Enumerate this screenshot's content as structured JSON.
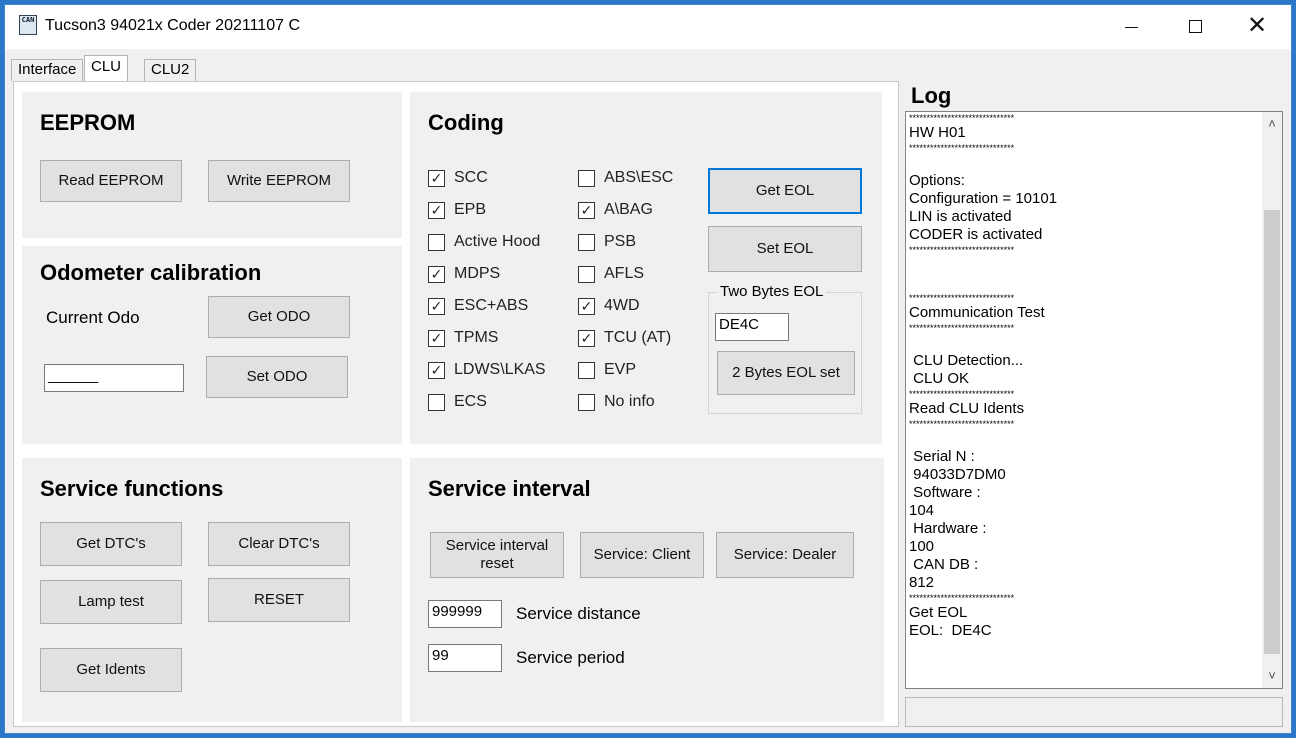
{
  "window": {
    "title": "Tucson3 94021x  Coder 20211107 C",
    "icon_text": "CAN",
    "close_glyph": "✕"
  },
  "tabs": [
    "Interface",
    "CLU",
    "CLU2"
  ],
  "eeprom": {
    "title": "EEPROM",
    "read_label": "Read EEPROM",
    "write_label": "Write EEPROM"
  },
  "odometer": {
    "title": "Odometer calibration",
    "current_label": "Current Odo",
    "get_label": "Get ODO",
    "set_label": "Set ODO",
    "input_value": "______"
  },
  "service_functions": {
    "title": "Service functions",
    "get_dtc": "Get DTC's",
    "clear_dtc": "Clear DTC's",
    "lamp_test": "Lamp test",
    "reset": "RESET",
    "get_idents": "Get Idents"
  },
  "coding": {
    "title": "Coding",
    "col1": [
      {
        "label": "SCC",
        "checked": true
      },
      {
        "label": "EPB",
        "checked": true
      },
      {
        "label": "Active Hood",
        "checked": false
      },
      {
        "label": "MDPS",
        "checked": true
      },
      {
        "label": "ESC+ABS",
        "checked": true
      },
      {
        "label": "TPMS",
        "checked": true
      },
      {
        "label": "LDWS\\LKAS",
        "checked": true
      },
      {
        "label": "ECS",
        "checked": false
      }
    ],
    "col2": [
      {
        "label": "ABS\\ESC",
        "checked": false
      },
      {
        "label": "A\\BAG",
        "checked": true
      },
      {
        "label": "PSB",
        "checked": false
      },
      {
        "label": "AFLS",
        "checked": false
      },
      {
        "label": "4WD",
        "checked": true
      },
      {
        "label": "TCU (AT)",
        "checked": true
      },
      {
        "label": "EVP",
        "checked": false
      },
      {
        "label": "No info",
        "checked": false
      }
    ],
    "get_eol": "Get EOL",
    "set_eol": "Set EOL",
    "two_bytes": {
      "label": "Two Bytes EOL",
      "value": "DE4C",
      "button": "2 Bytes EOL set"
    }
  },
  "service_interval": {
    "title": "Service interval",
    "reset_line1": "Service interval",
    "reset_line2": "reset",
    "client": "Service: Client",
    "dealer": "Service: Dealer",
    "distance_value": "999999",
    "distance_label": "Service distance",
    "period_value": "99",
    "period_label": "Service period"
  },
  "log": {
    "title": "Log",
    "lines": [
      "******************************",
      "HW H01",
      "******************************",
      "",
      "Options:",
      "Configuration = 10101",
      "LIN is activated",
      "CODER is activated",
      "******************************",
      "",
      "",
      "******************************",
      "Communication Test",
      "******************************",
      "",
      " CLU Detection...",
      " CLU OK",
      "******************************",
      "Read CLU Idents",
      "******************************",
      "",
      " Serial N :",
      " 94033D7DM0",
      " Software :",
      "104",
      " Hardware :",
      "100",
      " CAN DB :",
      "812",
      "******************************",
      "Get EOL",
      "EOL:  DE4C",
      "",
      "",
      "",
      "******************************"
    ]
  }
}
